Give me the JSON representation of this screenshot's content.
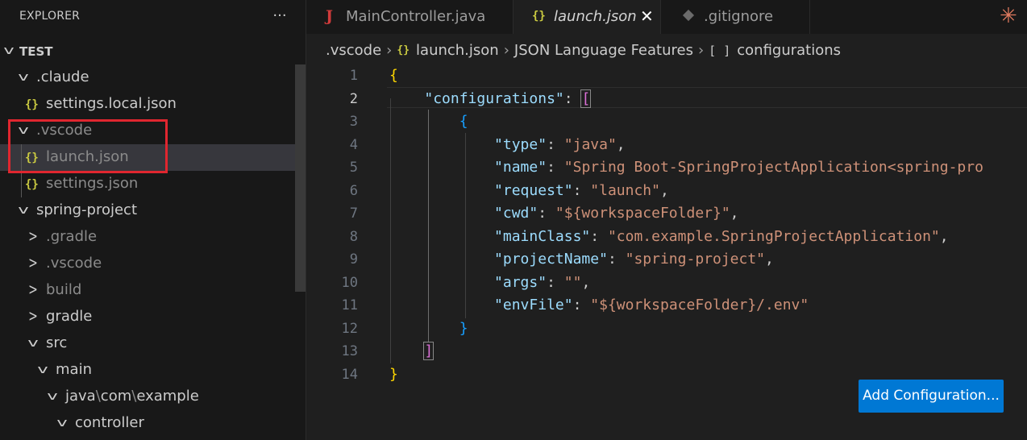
{
  "sidebar": {
    "title": "EXPLORER",
    "more": "···",
    "items": [
      {
        "label": "TEST"
      },
      {
        "label": ".claude"
      },
      {
        "label": "settings.local.json",
        "icon": "{}"
      },
      {
        "label": ".vscode"
      },
      {
        "label": "launch.json",
        "icon": "{}"
      },
      {
        "label": "settings.json",
        "icon": "{}"
      },
      {
        "label": "spring-project"
      },
      {
        "label": ".gradle"
      },
      {
        "label": ".vscode"
      },
      {
        "label": "build"
      },
      {
        "label": "gradle"
      },
      {
        "label": "src"
      },
      {
        "label": "main"
      },
      {
        "label": "java",
        "parts": [
          "java",
          "\\",
          "com",
          "\\",
          "example"
        ]
      },
      {
        "label": "controller"
      }
    ]
  },
  "tabs": [
    {
      "label": "MainController.java",
      "icon": "J"
    },
    {
      "label": "launch.json",
      "icon": "{}"
    },
    {
      "label": ".gitignore"
    }
  ],
  "tab_close": "✕",
  "breadcrumb": {
    "items": [
      ".vscode",
      "launch.json",
      "JSON Language Features",
      "configurations"
    ],
    "sep": "›",
    "json_icon": "{}",
    "array_icon": "[ ]"
  },
  "code": {
    "line_numbers": [
      "1",
      "2",
      "3",
      "4",
      "5",
      "6",
      "7",
      "8",
      "9",
      "10",
      "11",
      "12",
      "13",
      "14"
    ],
    "active_line": "2"
  },
  "add_configuration": "Add Configuration...",
  "icons": {
    "spark": "✳",
    "json": "braces-icon",
    "java": "java-icon",
    "git": "git-icon"
  },
  "colors": {
    "accent": "#0078d4",
    "highlight": "#e0262f"
  }
}
